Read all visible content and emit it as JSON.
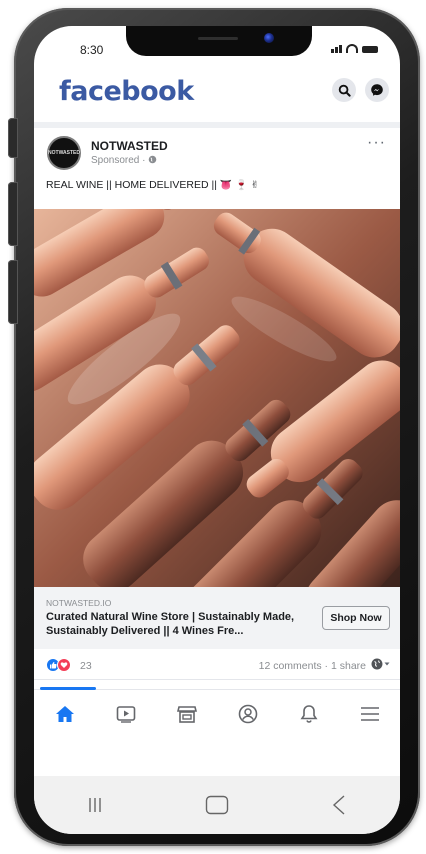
{
  "status_bar": {
    "time": "8:30"
  },
  "header": {
    "logo": "facebook",
    "brand_color": "#3b5aa3",
    "icons": [
      "search-icon",
      "messenger-icon"
    ]
  },
  "post": {
    "page_name": "NOTWASTED",
    "avatar_text": "NOTWASTED",
    "sponsored_label": "Sponsored ·",
    "text": "REAL WINE || HOME DELIVERED ||",
    "text_emojis": [
      "👅",
      "🍷",
      "✌"
    ],
    "link": {
      "domain": "NOTWASTED.IO",
      "title": "Curated Natural Wine Store | Sustainably Made, Sustainably Delivered || 4 Wines Fre...",
      "cta": "Shop Now"
    },
    "reactions": {
      "count": "23",
      "comments_shares": "12 comments · 1 share",
      "icons": [
        "like-icon",
        "love-icon"
      ]
    }
  },
  "bottom_nav": {
    "items": [
      "home-icon",
      "watch-icon",
      "marketplace-icon",
      "profile-icon",
      "notifications-icon",
      "menu-icon"
    ],
    "active": "home-icon",
    "accent": "#1877f2"
  },
  "system_nav": {
    "items": [
      "recent-apps-icon",
      "home-button-icon",
      "back-icon"
    ]
  }
}
